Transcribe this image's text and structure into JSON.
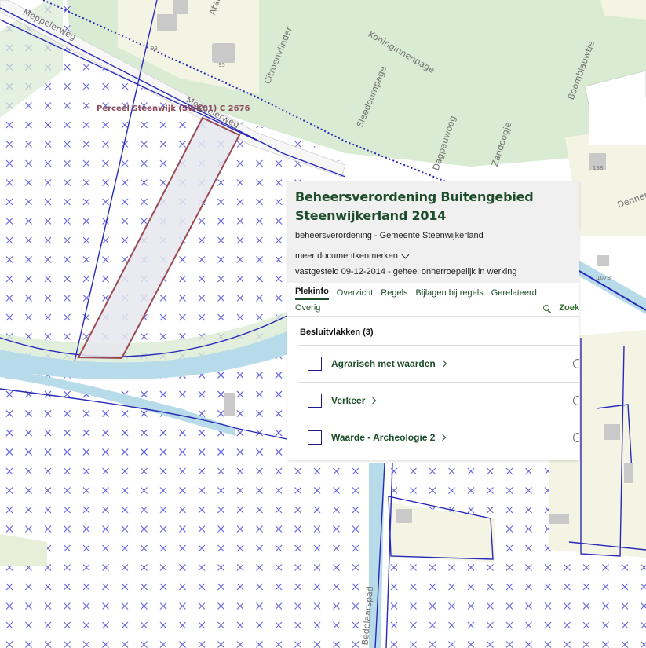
{
  "map": {
    "parcel_label": "Perceel Steenwijk (SWK01) C 2676",
    "streets": [
      "Meppelerweg",
      "Meppelerweg",
      "Citroenvlinder",
      "Koninginnenpage",
      "Sleedoornpage",
      "Dagpauwoog",
      "Zandoogje",
      "Boomblauwtje",
      "Dennen",
      "Bedelaarspad",
      "Atal"
    ],
    "house_numbers": [
      "93",
      "95",
      "138",
      "107B"
    ],
    "colors": {
      "green_zone": "#d9ebd3",
      "yellow_zone": "#f3f4e3",
      "plan_line": "#2a2ab8",
      "cross": "#6a6ae0",
      "water": "#b7dbe9",
      "parcel": "#9a4a55"
    }
  },
  "panel": {
    "title": "Beheersverordening Buitengebied Steenwijkerland 2014",
    "subtitle": "beheersverordening - Gemeente Steenwijkerland",
    "more_label": "meer documentkenmerken",
    "status": "vastgesteld 09-12-2014 - geheel onherroepelijk in werking",
    "tabs": [
      "Plekinfo",
      "Overzicht",
      "Regels",
      "Bijlagen bij regels",
      "Gerelateerd"
    ],
    "tab_overig": "Overig",
    "search_label": "Zoek",
    "section_title": "Besluitvlakken (3)",
    "planes": [
      "Agrarisch met waarden",
      "Verkeer",
      "Waarde - Archeologie 2"
    ]
  }
}
